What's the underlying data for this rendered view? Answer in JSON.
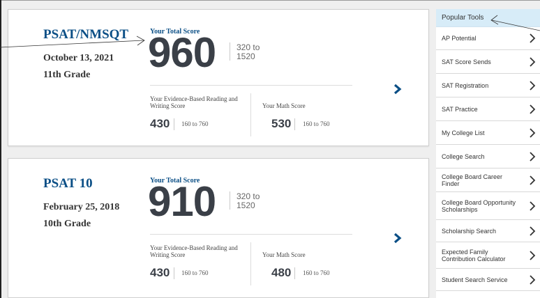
{
  "scores": [
    {
      "exam_name": "PSAT/NMSQT",
      "date": "October 13, 2021",
      "grade": "11th Grade",
      "total_label": "Your Total Score",
      "total_score": "960",
      "total_range_1": "320 to",
      "total_range_2": "1520",
      "ebrw_label": "Your Evidence-Based Reading and Writing Score",
      "ebrw_score": "430",
      "ebrw_range": "160 to 760",
      "math_label": "Your Math Score",
      "math_score": "530",
      "math_range": "160 to 760"
    },
    {
      "exam_name": "PSAT 10",
      "date": "February 25, 2018",
      "grade": "10th Grade",
      "total_label": "Your Total Score",
      "total_score": "910",
      "total_range_1": "320 to",
      "total_range_2": "1520",
      "ebrw_label": "Your Evidence-Based Reading and Writing Score",
      "ebrw_score": "430",
      "ebrw_range": "160 to 760",
      "math_label": "Your Math Score",
      "math_score": "480",
      "math_range": "160 to 760"
    }
  ],
  "sidebar": {
    "title": "Popular Tools",
    "items": [
      {
        "label": "AP Potential"
      },
      {
        "label": "SAT Score Sends"
      },
      {
        "label": "SAT Registration"
      },
      {
        "label": "SAT Practice"
      },
      {
        "label": "My College List"
      },
      {
        "label": "College Search"
      },
      {
        "label": "College Board Career Finder"
      },
      {
        "label": "College Board Opportunity Scholarships"
      },
      {
        "label": "Scholarship Search"
      },
      {
        "label": "Expected Family Contribution Calculator"
      },
      {
        "label": "Student Search Service"
      }
    ]
  },
  "colors": {
    "brand_blue": "#0b4f86",
    "score_gray": "#3a3f47",
    "sidebar_header_bg": "#d7ecf8"
  },
  "icons": {
    "card_arrow": "chevron-right-icon",
    "sidebar_chevron": "chevron-right-icon"
  }
}
